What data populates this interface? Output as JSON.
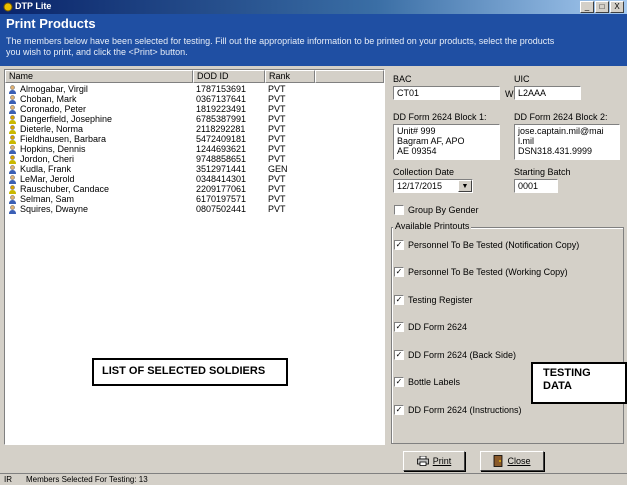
{
  "window": {
    "title": "DTP Lite",
    "min": "_",
    "max": "□",
    "close": "X"
  },
  "banner": {
    "title": "Print Products",
    "description": "The members below have been selected for testing.  Fill out the appropriate information to be printed on your products, select the products you wish to print, and click the <Print> button."
  },
  "list": {
    "headers": {
      "name": "Name",
      "dod": "DOD ID",
      "rank": "Rank"
    },
    "rows": [
      {
        "name": "Almogabar, Virgil",
        "dod": "1787153691",
        "rank": "PVT",
        "icon": "person-blue-icon"
      },
      {
        "name": "Choban, Mark",
        "dod": "0367137641",
        "rank": "PVT",
        "icon": "person-blue-icon"
      },
      {
        "name": "Coronado, Peter",
        "dod": "1819223491",
        "rank": "PVT",
        "icon": "person-blue-icon"
      },
      {
        "name": "Dangerfield, Josephine",
        "dod": "6785387991",
        "rank": "PVT",
        "icon": "person-female-icon"
      },
      {
        "name": "Dieterle, Norma",
        "dod": "2118292281",
        "rank": "PVT",
        "icon": "person-female-icon"
      },
      {
        "name": "Fieldhausen, Barbara",
        "dod": "5472409181",
        "rank": "PVT",
        "icon": "person-female-icon"
      },
      {
        "name": "Hopkins, Dennis",
        "dod": "1244693621",
        "rank": "PVT",
        "icon": "person-blue-icon"
      },
      {
        "name": "Jordon, Cheri",
        "dod": "9748858651",
        "rank": "PVT",
        "icon": "person-female-icon"
      },
      {
        "name": "Kudla, Frank",
        "dod": "3512971441",
        "rank": "GEN",
        "icon": "person-blue-icon"
      },
      {
        "name": "LeMar, Jerold",
        "dod": "0348414301",
        "rank": "PVT",
        "icon": "person-blue-icon"
      },
      {
        "name": "Rauschuber, Candace",
        "dod": "2209177061",
        "rank": "PVT",
        "icon": "person-female-icon"
      },
      {
        "name": "Selman, Sam",
        "dod": "6170197571",
        "rank": "PVT",
        "icon": "person-blue-icon"
      },
      {
        "name": "Squires, Dwayne",
        "dod": "0807502441",
        "rank": "PVT",
        "icon": "person-blue-icon"
      }
    ]
  },
  "callouts": {
    "soldiers": "LIST OF SELECTED SOLDIERS",
    "testing_line1": "TESTING",
    "testing_line2": "DATA"
  },
  "form": {
    "bac_label": "BAC",
    "bac_value": "CT01",
    "uic_label": "UIC",
    "uic_prefix": "W",
    "uic_value": "L2AAA",
    "block1_label": "DD Form 2624 Block 1:",
    "block1_lines": [
      "Unit# 999",
      "Bagram AF, APO",
      "AE 09354"
    ],
    "block2_label": "DD Form 2624 Block 2:",
    "block2_lines": [
      "jose.captain.mil@mai",
      "l.mil",
      "DSN318.431.9999"
    ],
    "collection_label": "Collection Date",
    "collection_value": "12/17/2015",
    "batch_label": "Starting Batch",
    "batch_value": "0001",
    "group_gender_label": "Group By Gender",
    "printouts_title": "Available Printouts",
    "printouts": [
      "Personnel To Be Tested (Notification Copy)",
      "Personnel To Be Tested (Working Copy)",
      "Testing Register",
      "DD Form 2624",
      "DD Form 2624 (Back Side)",
      "Bottle Labels",
      "DD Form 2624 (Instructions)"
    ]
  },
  "buttons": {
    "print": "Print",
    "close": "Close"
  },
  "status": {
    "left": "IR",
    "text": "Members Selected For Testing: 13"
  },
  "colors": {
    "banner": "#1f4fa3",
    "titlebar": "#0a246a",
    "face": "#d4d0c8"
  }
}
